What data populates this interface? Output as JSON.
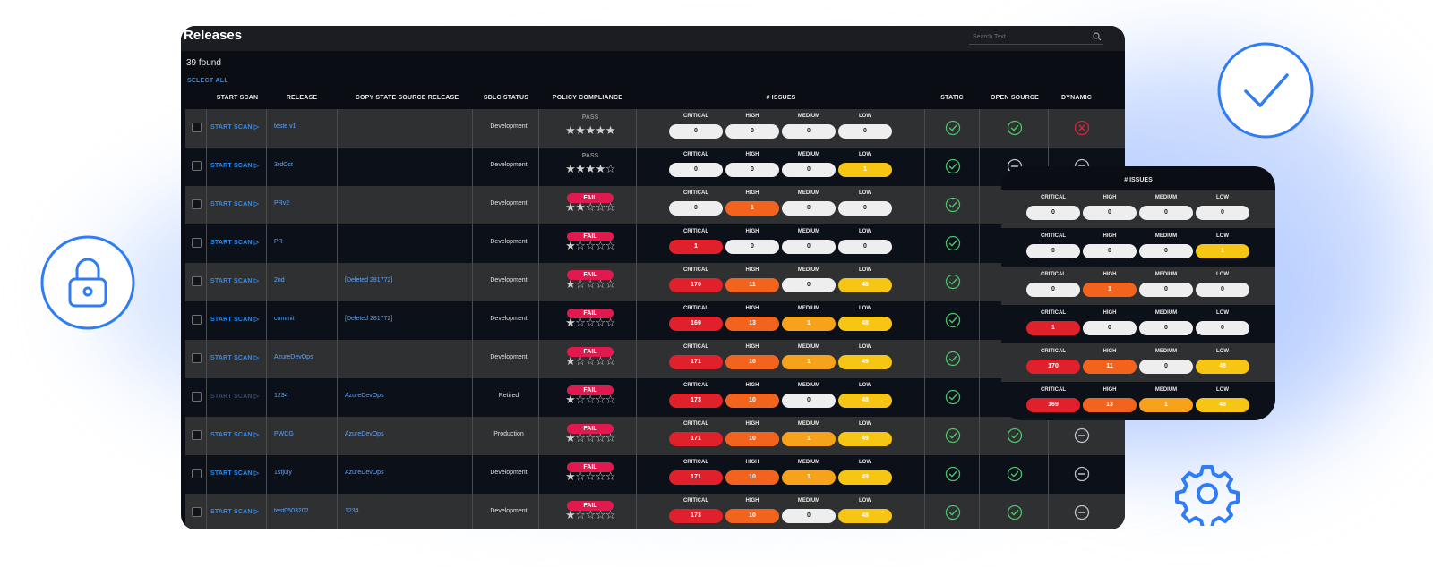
{
  "releases": {
    "title": "Releases",
    "search_placeholder": "Search Text",
    "found": "39 found",
    "select_all": "SELECT ALL",
    "headers": {
      "start_scan": "START SCAN",
      "release": "RELEASE",
      "copy_state": "COPY STATE SOURCE RELEASE",
      "sdlc": "SDLC STATUS",
      "policy": "POLICY COMPLIANCE",
      "issues": "# ISSUES",
      "static": "STATIC",
      "open_source": "OPEN SOURCE",
      "dynamic": "DYNAMIC"
    },
    "severity_labels": [
      "CRITICAL",
      "HIGH",
      "MEDIUM",
      "LOW"
    ],
    "start_scan_label": "START SCAN ▷",
    "rows": [
      {
        "release": "teste v1",
        "copy": "",
        "sdlc": "Development",
        "policy": "PASS",
        "stars": 5,
        "critical": "0",
        "high": "0",
        "medium": "0",
        "low": "0",
        "static": "check",
        "open_source": "check",
        "dynamic": "error",
        "scan_disabled": false
      },
      {
        "release": "3rdOct",
        "copy": "",
        "sdlc": "Development",
        "policy": "PASS",
        "stars": 4,
        "critical": "0",
        "high": "0",
        "medium": "0",
        "low": "1",
        "static": "check",
        "open_source": "minus",
        "dynamic": "minus",
        "scan_disabled": false
      },
      {
        "release": "PRv2",
        "copy": "",
        "sdlc": "Development",
        "policy": "FAIL",
        "stars": 2,
        "critical": "0",
        "high": "1",
        "medium": "0",
        "low": "0",
        "static": "check",
        "open_source": "",
        "dynamic": "",
        "scan_disabled": false
      },
      {
        "release": "PR",
        "copy": "",
        "sdlc": "Development",
        "policy": "FAIL",
        "stars": 1,
        "critical": "1",
        "high": "0",
        "medium": "0",
        "low": "0",
        "static": "check",
        "open_source": "",
        "dynamic": "",
        "scan_disabled": false
      },
      {
        "release": "2nd",
        "copy": "[Deleted 281772]",
        "sdlc": "Development",
        "policy": "FAIL",
        "stars": 1,
        "critical": "170",
        "high": "11",
        "medium": "0",
        "low": "48",
        "static": "check",
        "open_source": "",
        "dynamic": "",
        "scan_disabled": false
      },
      {
        "release": "commit",
        "copy": "[Deleted 281772]",
        "sdlc": "Development",
        "policy": "FAIL",
        "stars": 1,
        "critical": "169",
        "high": "13",
        "medium": "1",
        "low": "48",
        "static": "check",
        "open_source": "",
        "dynamic": "",
        "scan_disabled": false
      },
      {
        "release": "AzureDevOps",
        "copy": "",
        "sdlc": "Development",
        "policy": "FAIL",
        "stars": 1,
        "critical": "171",
        "high": "10",
        "medium": "1",
        "low": "49",
        "static": "check",
        "open_source": "",
        "dynamic": "",
        "scan_disabled": false
      },
      {
        "release": "1234",
        "copy": "AzureDevOps",
        "sdlc": "Retired",
        "policy": "FAIL",
        "stars": 1,
        "critical": "173",
        "high": "10",
        "medium": "0",
        "low": "48",
        "static": "check",
        "open_source": "",
        "dynamic": "",
        "scan_disabled": true
      },
      {
        "release": "PWCG",
        "copy": "AzureDevOps",
        "sdlc": "Production",
        "policy": "FAIL",
        "stars": 1,
        "critical": "171",
        "high": "10",
        "medium": "1",
        "low": "49",
        "static": "check",
        "open_source": "check",
        "dynamic": "minus",
        "scan_disabled": false
      },
      {
        "release": "1stjuly",
        "copy": "AzureDevOps",
        "sdlc": "Development",
        "policy": "FAIL",
        "stars": 1,
        "critical": "171",
        "high": "10",
        "medium": "1",
        "low": "49",
        "static": "check",
        "open_source": "check",
        "dynamic": "minus",
        "scan_disabled": false
      },
      {
        "release": "test0503202",
        "copy": "1234",
        "sdlc": "Development",
        "policy": "FAIL",
        "stars": 1,
        "critical": "173",
        "high": "10",
        "medium": "0",
        "low": "48",
        "static": "check",
        "open_source": "check",
        "dynamic": "minus",
        "scan_disabled": false
      }
    ]
  },
  "issues_card": {
    "title": "# ISSUES",
    "rows": [
      {
        "critical": "0",
        "high": "0",
        "medium": "0",
        "low": "0"
      },
      {
        "critical": "0",
        "high": "0",
        "medium": "0",
        "low": "1"
      },
      {
        "critical": "0",
        "high": "1",
        "medium": "0",
        "low": "0"
      },
      {
        "critical": "1",
        "high": "0",
        "medium": "0",
        "low": "0"
      },
      {
        "critical": "170",
        "high": "11",
        "medium": "0",
        "low": "48"
      },
      {
        "critical": "169",
        "high": "13",
        "medium": "1",
        "low": "48"
      }
    ]
  },
  "colors": {
    "critical": "#e0202a",
    "high": "#f2641e",
    "medium": "#f7a21b",
    "low": "#f7c514",
    "zero": "#eeeeee",
    "accent": "#2d8cf0",
    "fail": "#e01a4f",
    "check": "#4cc36b",
    "error": "#d9263f",
    "minus": "#bfc3c9",
    "deco": "#2f7df6"
  },
  "decor_icons": [
    "lock-icon",
    "checkmark-circle-icon",
    "gear-icon"
  ]
}
